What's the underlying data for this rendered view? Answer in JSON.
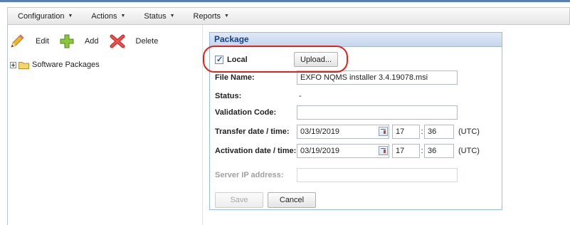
{
  "menu": {
    "items": [
      {
        "label": "Configuration"
      },
      {
        "label": "Actions"
      },
      {
        "label": "Status"
      },
      {
        "label": "Reports"
      }
    ]
  },
  "toolbar": {
    "edit_label": "Edit",
    "add_label": "Add",
    "delete_label": "Delete"
  },
  "tree": {
    "root_label": "Software Packages"
  },
  "package": {
    "title": "Package",
    "local_label": "Local",
    "local_checked": true,
    "upload_label": "Upload...",
    "file_name_label": "File Name:",
    "file_name_value": "EXFO NQMS installer 3.4.19078.msi",
    "status_label": "Status:",
    "status_value": "-",
    "validation_label": "Validation Code:",
    "validation_value": "",
    "transfer_label": "Transfer date / time:",
    "transfer_date": "03/19/2019",
    "transfer_hour": "17",
    "transfer_minute": "36",
    "transfer_tz": "(UTC)",
    "activation_label": "Activation date / time:",
    "activation_date": "03/19/2019",
    "activation_hour": "17",
    "activation_minute": "36",
    "activation_tz": "(UTC)",
    "server_ip_label": "Server IP address:",
    "server_ip_value": "",
    "save_label": "Save",
    "cancel_label": "Cancel"
  },
  "colors": {
    "accent": "#5b7fb8",
    "panel_header": "#15428b",
    "annotation": "#e2231a"
  }
}
